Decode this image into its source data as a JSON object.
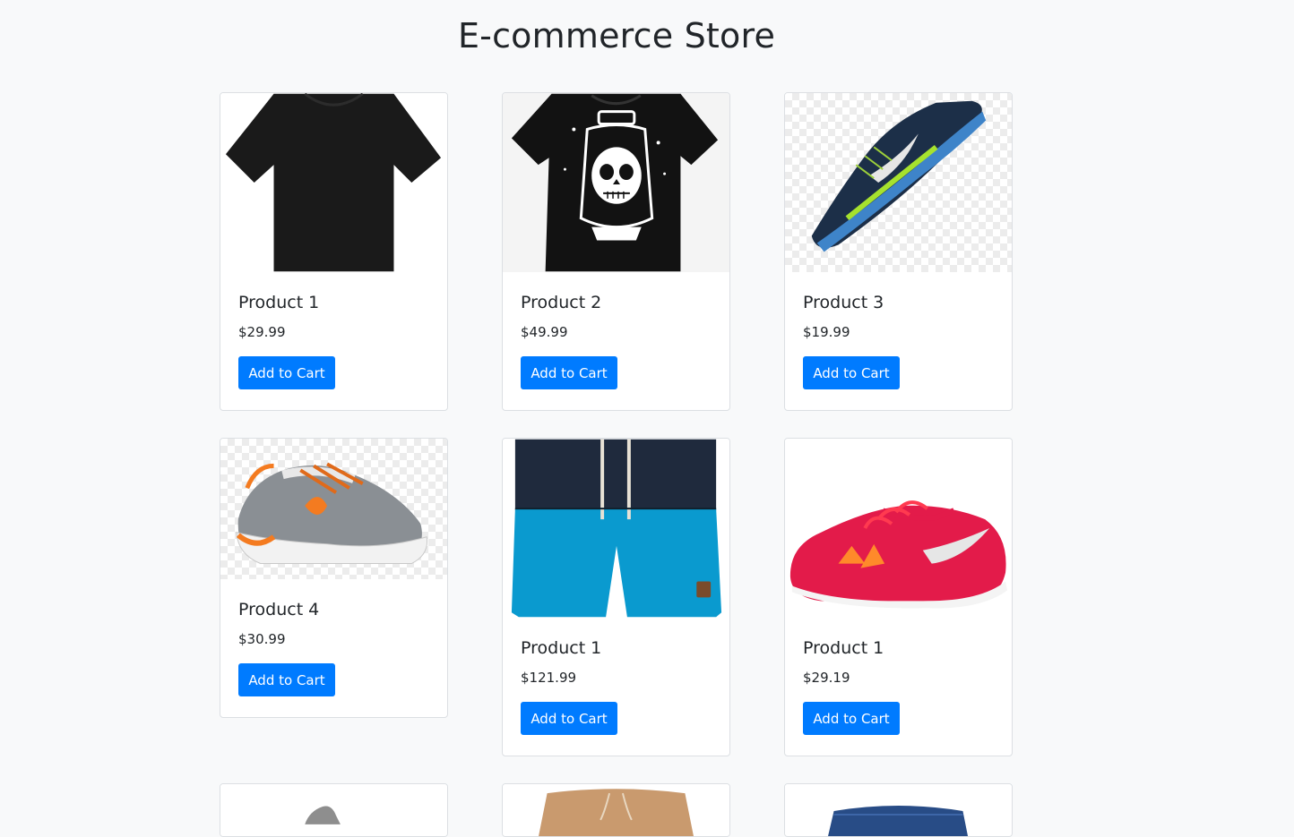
{
  "page": {
    "title": "E-commerce Store"
  },
  "products": [
    {
      "name": "Product 1",
      "price": "$29.99",
      "button": "Add to Cart",
      "image": "black-tshirt-image"
    },
    {
      "name": "Product 2",
      "price": "$49.99",
      "button": "Add to Cart",
      "image": "skull-print-tshirt-image"
    },
    {
      "name": "Product 3",
      "price": "$19.99",
      "button": "Add to Cart",
      "image": "blue-running-shoe-image"
    },
    {
      "name": "Product 4",
      "price": "$30.99",
      "button": "Add to Cart",
      "image": "gray-orange-sneaker-image"
    },
    {
      "name": "Product 1",
      "price": "$121.99",
      "button": "Add to Cart",
      "image": "blue-swim-shorts-image"
    },
    {
      "name": "Product 1",
      "price": "$29.19",
      "button": "Add to Cart",
      "image": "red-running-shoe-image"
    }
  ],
  "partial_products": [
    {
      "image": "silver-shoe-image"
    },
    {
      "image": "tan-shorts-image"
    },
    {
      "image": "denim-shorts-image"
    }
  ]
}
